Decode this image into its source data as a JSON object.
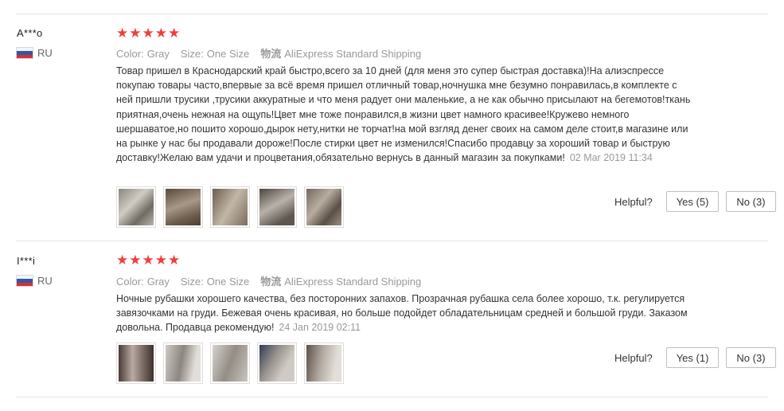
{
  "reviews": [
    {
      "user": "A***o",
      "country": "RU",
      "stars": "★★★★★",
      "color_label": "Color:",
      "color_value": "Gray",
      "size_label": "Size:",
      "size_value": "One Size",
      "shipping_label": "物流",
      "shipping_value": "AliExpress Standard Shipping",
      "text": "Товар пришел в Краснодарский край быстро,всего за 10 дней (для меня это супер быстрая доставка)!На алиэспрессе покупаю товары часто,впервые за всё время пришел отличный товар,ночнушка мне безумно понравилась,в комплекте с ней пришли трусики ,трусики аккуратные и что меня радует они маленькие, а не как обычно присылают на бегемотов!ткань приятная,очень нежная на ощупь!Цвет мне тоже понравился,в жизни цвет намного красивее!Кружево немного шершаватое,но пошито хорошо,дырок нету,нитки не торчат!на мой взгляд денег своих на самом деле стоит,в магазине или на рынке у нас бы продавали дороже!После стирки цвет не изменился!Спасибо продавцу за хороший товар и быструю доставку!Желаю вам удачи и процветания,обязательно вернусь в данный магазин за покупками!",
      "date": "02 Mar 2019 11:34",
      "helpful_label": "Helpful?",
      "yes_label": "Yes (5)",
      "no_label": "No (3)"
    },
    {
      "user": "I***i",
      "country": "RU",
      "stars": "★★★★★",
      "color_label": "Color:",
      "color_value": "Gray",
      "size_label": "Size:",
      "size_value": "One Size",
      "shipping_label": "物流",
      "shipping_value": "AliExpress Standard Shipping",
      "text": "Ночные рубашки хорошего качества, без посторонних запахов. Прозрачная рубашка села более хорошо, т.к. регулируется завязочками на груди. Бежевая очень красивая, но больше подойдет обладательницам средней и большой груди. Заказом довольна. Продавца рекомендую!",
      "date": "24 Jan 2019 02:11",
      "helpful_label": "Helpful?",
      "yes_label": "Yes (1)",
      "no_label": "No (3)"
    }
  ],
  "colors": {
    "star": "#f03e3e",
    "meta_text": "#999999",
    "border": "#e5e5e5"
  }
}
